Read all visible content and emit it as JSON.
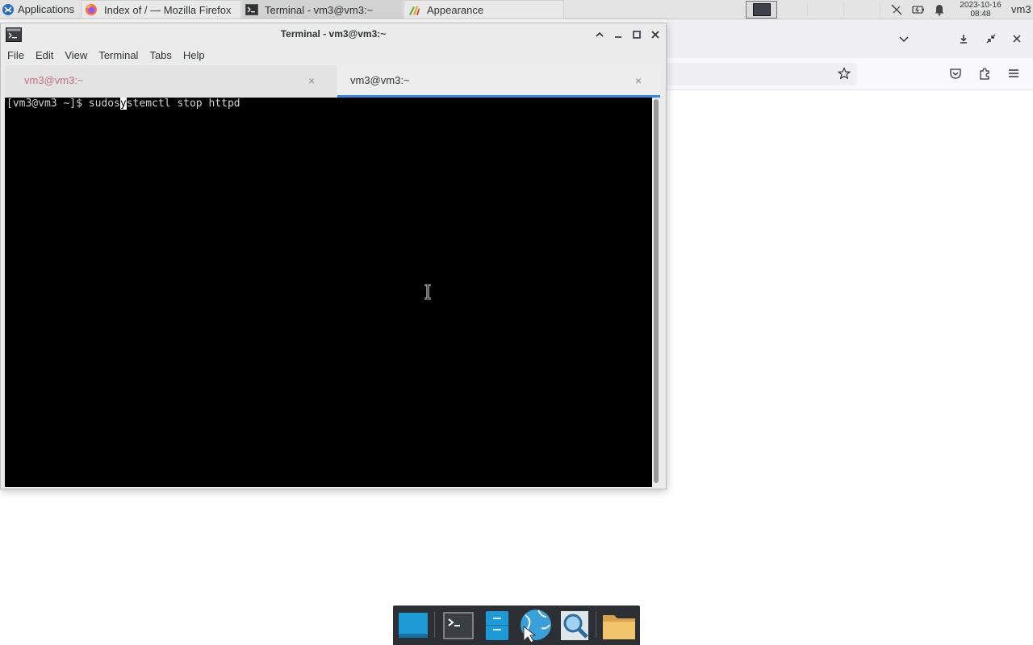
{
  "panel": {
    "apps_label": "Applications",
    "tasks": [
      {
        "label": "Index of / — Mozilla Firefox",
        "icon": "firefox-icon"
      },
      {
        "label": "Terminal - vm3@vm3:~",
        "icon": "terminal-icon"
      },
      {
        "label": "Appearance",
        "icon": "appearance-icon"
      }
    ],
    "clock_date": "2023-10-16",
    "clock_time": "08:48",
    "user": "vm3",
    "tray_icons": [
      "network-disconnected-icon",
      "battery-icon",
      "notification-bell-icon"
    ]
  },
  "firefox": {
    "toolbar_icons": [
      "chevron-down-icon",
      "download-icon",
      "exit-fullscreen-icon",
      "close-icon",
      "bookmark-star-icon",
      "pocket-icon",
      "extensions-icon",
      "hamburger-menu-icon"
    ]
  },
  "terminal": {
    "title": "Terminal - vm3@vm3:~",
    "menu": [
      "File",
      "Edit",
      "View",
      "Terminal",
      "Tabs",
      "Help"
    ],
    "tabs": [
      {
        "label": "vm3@vm3:~",
        "active": false
      },
      {
        "label": "vm3@vm3:~",
        "active": true
      }
    ],
    "prompt": "[vm3@vm3 ~]$ ",
    "command_before_cursor": "sudos",
    "cursor_char": "y",
    "command_after_cursor": "stemctl stop httpd",
    "accent_color": "#3584e4"
  },
  "dock": {
    "items": [
      "show-desktop-icon",
      "terminal-icon",
      "file-manager-icon",
      "web-browser-icon",
      "app-finder-icon",
      "folder-icon"
    ]
  }
}
